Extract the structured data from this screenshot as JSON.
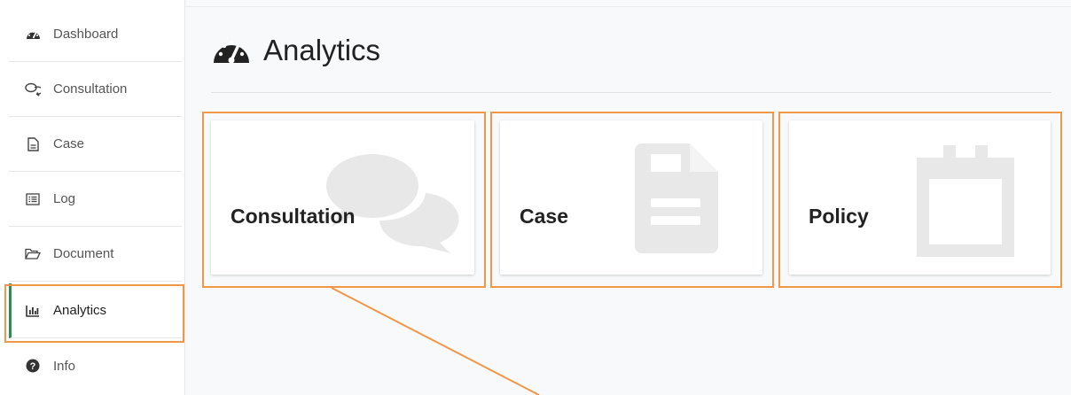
{
  "sidebar": {
    "items": [
      {
        "label": "Dashboard",
        "icon": "tachometer-icon"
      },
      {
        "label": "Consultation",
        "icon": "comments-icon"
      },
      {
        "label": "Case",
        "icon": "file-icon"
      },
      {
        "label": "Log",
        "icon": "list-icon"
      },
      {
        "label": "Document",
        "icon": "folder-open-icon"
      },
      {
        "label": "Analytics",
        "icon": "bar-chart-icon",
        "active": true
      },
      {
        "label": "Info",
        "icon": "question-circle-icon"
      }
    ]
  },
  "header": {
    "title": "Analytics",
    "icon": "tachometer-icon"
  },
  "cards": [
    {
      "label": "Consultation",
      "icon": "comments-icon"
    },
    {
      "label": "Case",
      "icon": "file-text-icon"
    },
    {
      "label": "Policy",
      "icon": "calendar-icon"
    }
  ],
  "colors": {
    "highlight": "#f0974a",
    "active_indicator": "#2e8b57",
    "watermark_icon": "#e8e8e8"
  }
}
